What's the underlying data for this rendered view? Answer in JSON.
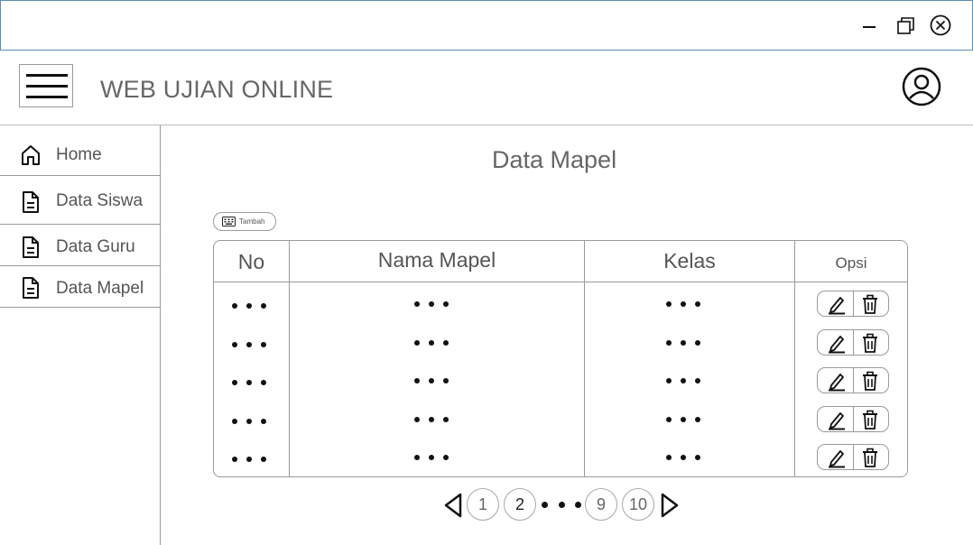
{
  "window": {
    "controls": [
      "minimize-icon",
      "restore-icon",
      "close-icon"
    ]
  },
  "header": {
    "title": "WEB UJIAN ONLINE",
    "menu_icon": "hamburger-icon",
    "profile_icon": "user-circle-icon"
  },
  "sidebar": {
    "items": [
      {
        "label": "Home",
        "icon": "home-icon"
      },
      {
        "label": "Data Siswa",
        "icon": "document-icon"
      },
      {
        "label": "Data Guru",
        "icon": "document-icon"
      },
      {
        "label": "Data Mapel",
        "icon": "document-icon"
      }
    ]
  },
  "main": {
    "title": "Data Mapel",
    "add_button": {
      "label": "Tambah",
      "icon": "keyboard-icon"
    },
    "table": {
      "columns": [
        "No",
        "Nama Mapel",
        "Kelas",
        "Opsi"
      ],
      "row_count": 5,
      "placeholder": "• • •",
      "actions": [
        "edit-icon",
        "trash-icon"
      ]
    },
    "pagination": {
      "pages": [
        "1",
        "2",
        "9",
        "10"
      ],
      "current": "2",
      "ellipsis": "• • •"
    }
  }
}
